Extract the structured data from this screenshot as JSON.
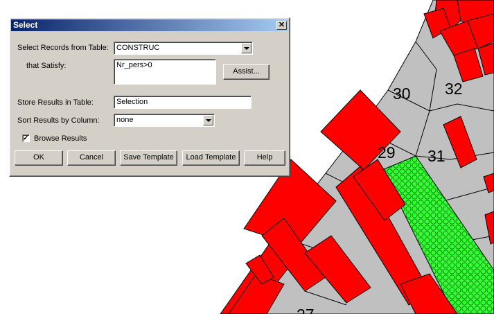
{
  "dialog": {
    "title": "Select",
    "close_glyph": "✕",
    "select_records_label": "Select Records from Table:",
    "table_value": "CONSTRUC",
    "satisfy_label": "that Satisfy:",
    "condition_value": "Nr_pers>0",
    "assist_label": "Assist...",
    "store_label": "Store Results in Table:",
    "store_value": "Selection",
    "sort_label": "Sort Results by Column:",
    "sort_value": "none",
    "browse_label": "Browse Results",
    "browse_checked": true,
    "buttons": {
      "ok": "OK",
      "cancel": "Cancel",
      "save_template": "Save Template",
      "load_template": "Load Template",
      "help": "Help"
    }
  },
  "map": {
    "parcel_labels": [
      "30",
      "32",
      "29",
      "31",
      "27"
    ],
    "colors": {
      "building": "#ff0000",
      "parcel": "#c0c0c0",
      "selected": "#33ff33",
      "outline": "#000000"
    }
  }
}
